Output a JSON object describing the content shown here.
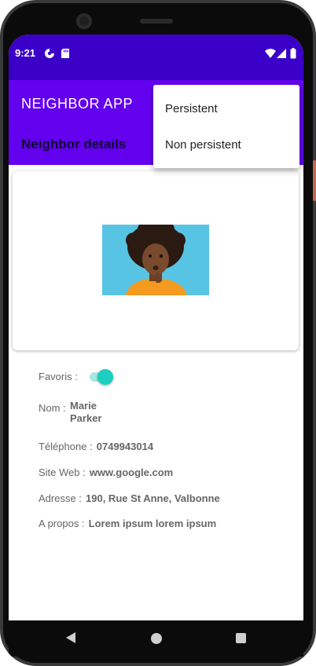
{
  "status_bar": {
    "time": "9:21",
    "left_icons": [
      "data-saver-icon",
      "sd-card-icon"
    ],
    "right_icons": [
      "wifi-icon",
      "signal-icon",
      "battery-icon"
    ]
  },
  "app_bar": {
    "title": "NEIGHBOR APP",
    "subtitle": "Neighbor details"
  },
  "overflow_menu": {
    "items": [
      {
        "label": "Persistent"
      },
      {
        "label": "Non persistent"
      }
    ]
  },
  "details": {
    "favorite": {
      "label": "Favoris :",
      "checked": true
    },
    "name": {
      "label": "Nom :",
      "first": "Marie",
      "last": "Parker"
    },
    "phone": {
      "label": "Téléphone :",
      "value": "0749943014"
    },
    "website": {
      "label": "Site Web :",
      "value": "www.google.com"
    },
    "address": {
      "label": "Adresse :",
      "value": "190, Rue St Anne, Valbonne"
    },
    "about": {
      "label": "A propos :",
      "value": "Lorem ipsum lorem ipsum"
    }
  },
  "colors": {
    "status_bar": "#3b00c8",
    "app_bar": "#6300ee",
    "toggle_accent": "#1ccfc1"
  },
  "nav_bar": {
    "icons": [
      "back-icon",
      "home-icon",
      "recent-apps-icon"
    ]
  }
}
